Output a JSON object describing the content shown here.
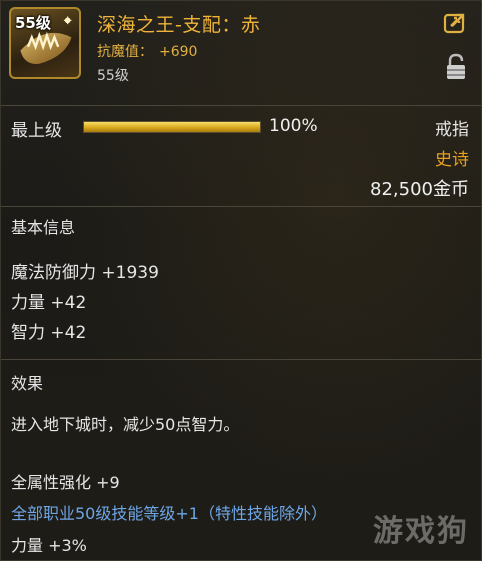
{
  "header": {
    "icon_level": "55级",
    "item_name": "深海之王-支配：赤",
    "resist_label": "抗魔值：",
    "resist_value": "+690",
    "req_level": "55级"
  },
  "grade": {
    "label": "最上级",
    "percent_text": "100%",
    "fill_fraction": 1.0
  },
  "meta": {
    "type": "戒指",
    "rarity": "史诗",
    "price": "82,500金币"
  },
  "basic_info": {
    "title": "基本信息",
    "stats": [
      "魔法防御力 +1939",
      "力量 +42",
      "智力 +42"
    ]
  },
  "effects": {
    "title": "效果",
    "description": "进入地下城时，减少50点智力。",
    "all_attr": "全属性强化 +9",
    "skill_bonus": "全部职业50级技能等级+1（特性技能除外）",
    "strength_pct": "力量 +3%"
  },
  "watermark": "游戏狗",
  "colors": {
    "title_gold": "#f0b43a",
    "rarity_orange": "#e8a21f",
    "skill_blue": "#6ea6e6",
    "bar_gold": "#d9a91b"
  },
  "icons": [
    "share-icon",
    "lock-icon",
    "ring-item-icon"
  ]
}
